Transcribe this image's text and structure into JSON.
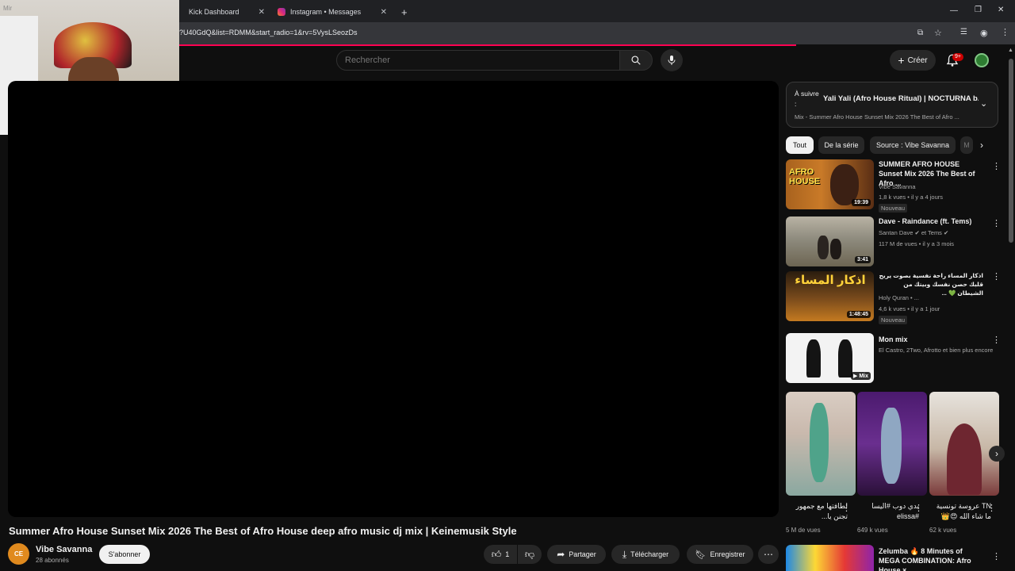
{
  "browser": {
    "tabs": [
      {
        "title": "Kick Dashboard"
      },
      {
        "title": "Instagram • Messages"
      }
    ],
    "new_tab_label": "+",
    "url": "?U40GdQ&list=RDMM&start_radio=1&rv=5VysLSeozDs",
    "webcam_label": "Mir"
  },
  "header": {
    "search_placeholder": "Rechercher",
    "create_label": "Créer",
    "notifications_badge": "9+"
  },
  "video": {
    "title": "Summer Afro House Sunset Mix 2026 The Best of Afro House deep afro music dj mix | Keinemusik Style",
    "channel": "Vibe Savanna",
    "channel_avatar_text": "CE",
    "subscribers": "28 abonnés",
    "subscribe_label": "S'abonner",
    "likes": "1",
    "share_label": "Partager",
    "download_label": "Télécharger",
    "save_label": "Enregistrer"
  },
  "up_next": {
    "label": "À suivre :",
    "title": "Yali Yali (Afro House Ritual) | NOCTURNA b...",
    "subtitle": "Mix - Summer Afro House Sunset Mix 2026 The Best of Afro ..."
  },
  "chips": [
    "Tout",
    "De la série",
    "Source : Vibe Savanna",
    "M"
  ],
  "recommendations": [
    {
      "title": "SUMMER AFRO HOUSE Sunset Mix 2026 The Best of Afro ...",
      "channel": "Vibe Savanna",
      "meta": "1,8 k vues • il y a 4 jours",
      "badge": "Nouveau",
      "duration": "19:39",
      "thumb_text": "AFRO HOUSE"
    },
    {
      "title": "Dave - Raindance (ft. Tems)",
      "channel": "Santan Dave ✔ et Tems ✔",
      "meta": "117 M de vues • il y a 3 mois",
      "badge": "",
      "duration": "3:41",
      "thumb_text": ""
    },
    {
      "title": "اذكار المساء راحة نفسية بصوت يريح قلبك حصن نفسك وبيتك من الشيطان 💚 ...",
      "channel": "Holy Quran • ...",
      "meta": "4,6 k vues • il y a 1 jour",
      "badge": "Nouveau",
      "duration": "1:48:45",
      "thumb_text": "اذكار المساء"
    },
    {
      "title": "Mon mix",
      "channel": "El Castro, 2Two, Afrotto et bien plus encore",
      "meta": "",
      "badge": "",
      "duration": "Mix",
      "thumb_text": ""
    }
  ],
  "shorts": [
    {
      "title": "لطافتها مع جمهور تجنن يا...",
      "views": "5 M de vues"
    },
    {
      "title": "بدي دوب #اليسا #elissa",
      "views": "649 k vues"
    },
    {
      "title": "TN عروسة تونسية ما شاء الله 😍👑",
      "views": "62 k vues"
    }
  ],
  "last_recommendation": {
    "title": "Zelumba 🔥 8 Minutes of MEGA COMBINATION: Afro House × ..."
  },
  "colors": {
    "bg": "#0f0f0f",
    "accent": "#ff0052",
    "chip": "#272727"
  }
}
